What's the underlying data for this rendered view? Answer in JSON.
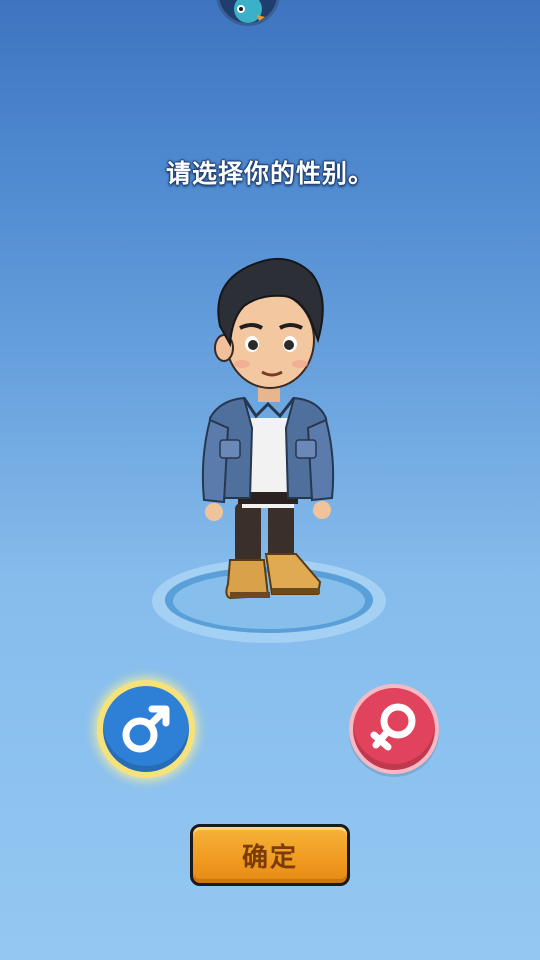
{
  "prompt": {
    "text": "请选择你的性别。"
  },
  "gender": {
    "male": {
      "icon": "male-symbol-icon",
      "color": "#2e7fd6",
      "selected": true
    },
    "female": {
      "icon": "female-symbol-icon",
      "color": "#e0435b",
      "selected": false
    }
  },
  "confirm": {
    "label": "确定",
    "color": "#f09a20"
  },
  "character": {
    "icon": "male-avatar"
  },
  "top_badge": {
    "icon": "mascot-icon"
  }
}
